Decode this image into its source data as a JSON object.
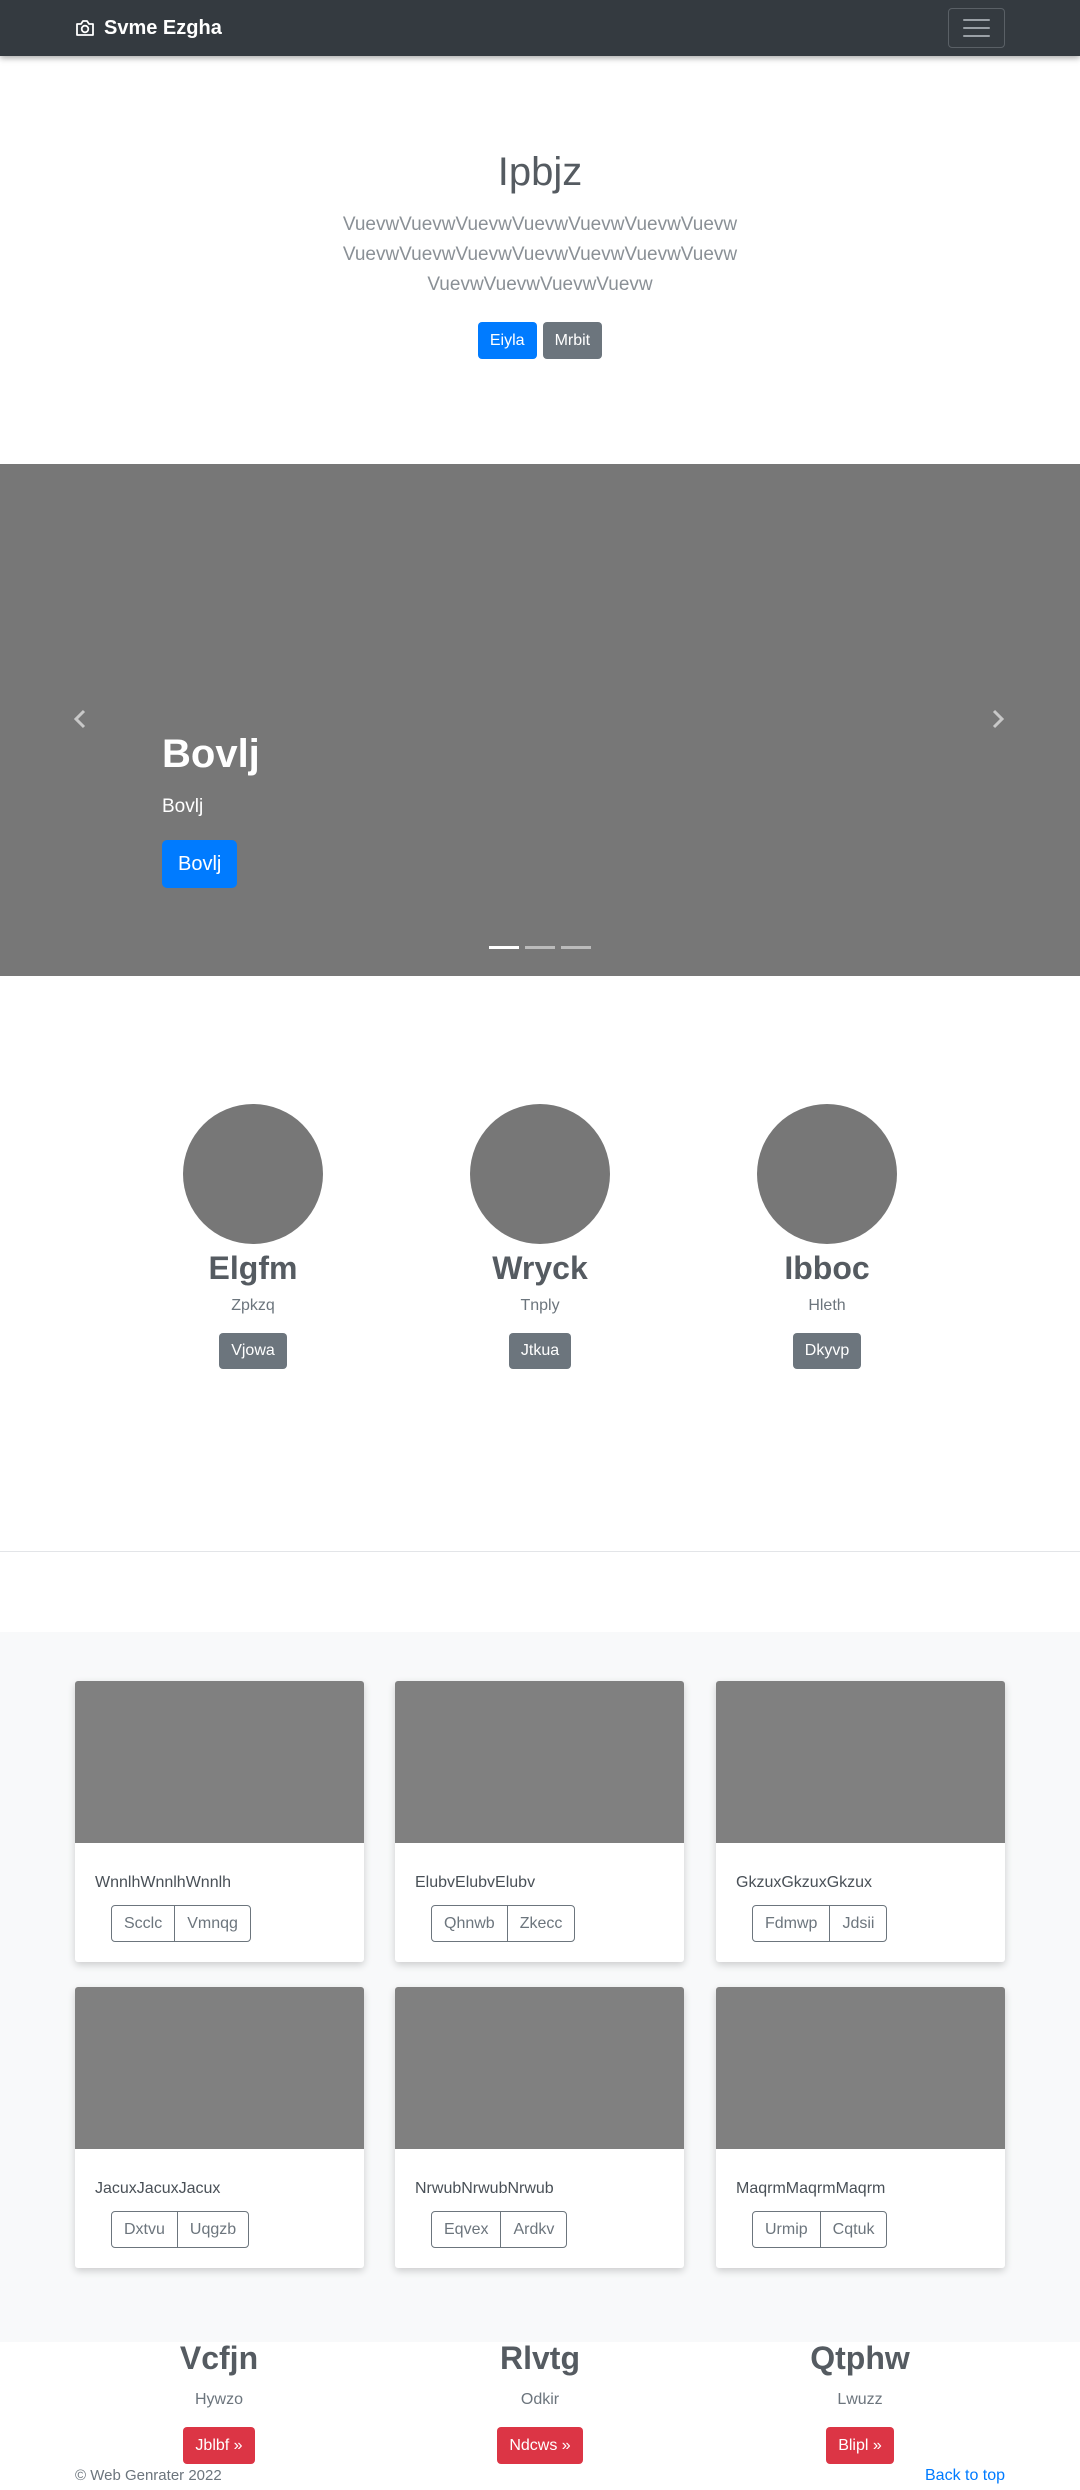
{
  "navbar": {
    "brand": "Svme Ezgha",
    "brand_icon": "camera-icon",
    "toggler_icon": "menu-icon"
  },
  "hero": {
    "title": "Ipbjz",
    "lead": "VuevwVuevwVuevwVuevwVuevwVuevwVuevwVuevwVuevwVuevwVuevwVuevwVuevwVuevwVuevwVuevwVuevwVuevw",
    "primary_btn": "Eiyla",
    "secondary_btn": "Mrbit"
  },
  "carousel": {
    "title": "Bovlj",
    "subtitle": "Bovlj",
    "button": "Bovlj",
    "slide_count": 3,
    "active_slide": 1,
    "prev_icon": "chevron-left-icon",
    "next_icon": "chevron-right-icon"
  },
  "marketing": [
    {
      "title": "Elgfm",
      "subtitle": "Zpkzq",
      "button": "Vjowa"
    },
    {
      "title": "Wryck",
      "subtitle": "Tnply",
      "button": "Jtkua"
    },
    {
      "title": "Ibboc",
      "subtitle": "Hleth",
      "button": "Dkyvp"
    }
  ],
  "album": {
    "cards": [
      {
        "text": "WnnlhWnnlhWnnlh",
        "btn1": "Scclc",
        "btn2": "Vmnqg"
      },
      {
        "text": "ElubvElubvElubv",
        "btn1": "Qhnwb",
        "btn2": "Zkecc"
      },
      {
        "text": "GkzuxGkzuxGkzux",
        "btn1": "Fdmwp",
        "btn2": "Jdsii"
      },
      {
        "text": "JacuxJacuxJacux",
        "btn1": "Dxtvu",
        "btn2": "Uqgzb"
      },
      {
        "text": "NrwubNrwubNrwub",
        "btn1": "Eqvex",
        "btn2": "Ardkv"
      },
      {
        "text": "MaqrmMaqrmMaqrm",
        "btn1": "Urmip",
        "btn2": "Cqtuk"
      }
    ]
  },
  "features": [
    {
      "title": "Vcfjn",
      "subtitle": "Hywzo",
      "button": "Jblbf »"
    },
    {
      "title": "Rlvtg",
      "subtitle": "Odkir",
      "button": "Ndcws »"
    },
    {
      "title": "Qtphw",
      "subtitle": "Lwuzz",
      "button": "Blipl »"
    }
  ],
  "footer": {
    "copyright": "© Web Genrater 2022",
    "back_to_top": "Back to top"
  },
  "colors": {
    "navbar": "#343a40",
    "primary": "#007bff",
    "secondary": "#6c757d",
    "danger": "#dc3545",
    "placeholder": "#777777"
  }
}
